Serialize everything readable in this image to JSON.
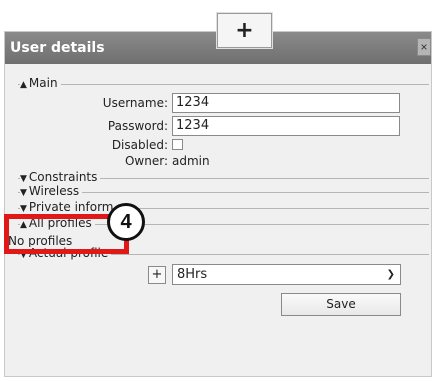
{
  "dialog": {
    "title": "User details",
    "close_glyph": "×"
  },
  "callout": {
    "plus_glyph": "+"
  },
  "sections": {
    "main": "Main",
    "constraints": "Constraints",
    "wireless": "Wireless",
    "private_info": "Private inform",
    "all_profiles": "All profiles",
    "actual_profile": "Actual profile"
  },
  "fields": {
    "username_label": "Username:",
    "username_value": "1234",
    "password_label": "Password:",
    "password_value": "1234",
    "disabled_label": "Disabled:",
    "owner_label": "Owner:",
    "owner_value": "admin"
  },
  "all_profiles": {
    "empty_text": "No profiles"
  },
  "actual_profile": {
    "add_button": "+",
    "selected": "8Hrs",
    "save_label": "Save"
  },
  "annotation": {
    "step_number": "4"
  },
  "colors": {
    "titlebar": "#7c7c7c",
    "annotation_red": "#e01818"
  },
  "icons": {
    "expanded": "triangle-up-icon",
    "collapsed": "triangle-down-icon",
    "dropdown": "chevron-down-icon"
  }
}
